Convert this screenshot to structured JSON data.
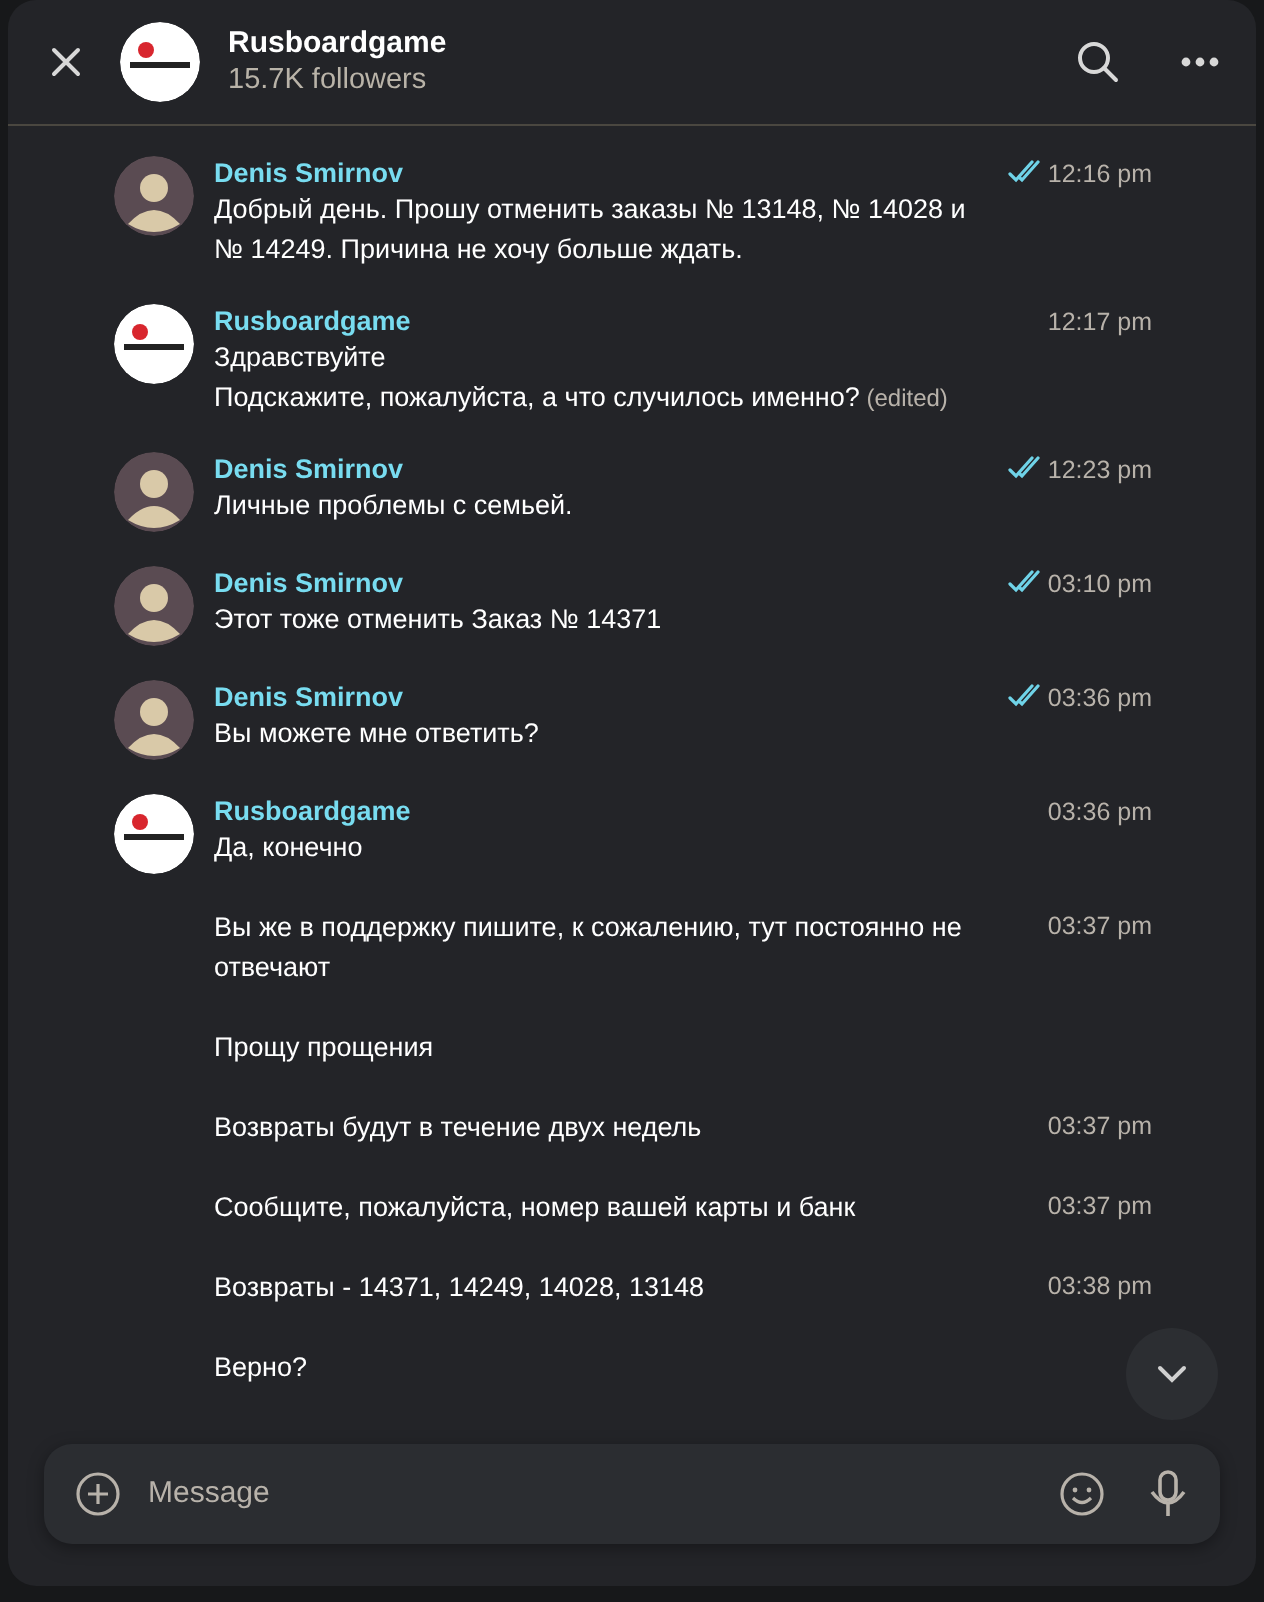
{
  "header": {
    "title": "Rusboardgame",
    "subtitle": "15.7K followers"
  },
  "groups": [
    {
      "sender": "Denis Smirnov",
      "kind": "person",
      "messages": [
        {
          "text": "Добрый день. Прошу отменить заказы № 13148, № 14028 и № 14249. Причина не хочу больше ждать.",
          "time": "12:16 pm",
          "read": true
        }
      ]
    },
    {
      "sender": "Rusboardgame",
      "kind": "logo",
      "messages": [
        {
          "text": "Здравствуйте\nПодскажите, пожалуйста, а что случилось именно?",
          "edited": "(edited)",
          "time": "12:17 pm",
          "read": false
        }
      ]
    },
    {
      "sender": "Denis Smirnov",
      "kind": "person",
      "messages": [
        {
          "text": "Личные проблемы с семьей.",
          "time": "12:23 pm",
          "read": true
        }
      ]
    },
    {
      "sender": "Denis Smirnov",
      "kind": "person",
      "messages": [
        {
          "text": "Этот тоже отменить Заказ № 14371",
          "time": "03:10 pm",
          "read": true
        }
      ]
    },
    {
      "sender": "Denis Smirnov",
      "kind": "person",
      "messages": [
        {
          "text": "Вы можете мне ответить?",
          "time": "03:36 pm",
          "read": true
        }
      ]
    },
    {
      "sender": "Rusboardgame",
      "kind": "logo",
      "messages": [
        {
          "text": "Да, конечно",
          "time": "03:36 pm",
          "read": false
        },
        {
          "text": "Вы же в поддержку пишите, к сожалению, тут постоянно не отвечают",
          "time": "03:37 pm",
          "read": false
        },
        {
          "text": "Прощу прощения",
          "read": false
        },
        {
          "text": "Возвраты будут в течение двух недель",
          "time": "03:37 pm",
          "read": false
        },
        {
          "text": "Сообщите, пожалуйста, номер вашей карты и банк",
          "time": "03:37 pm",
          "read": false
        },
        {
          "text": "Возвраты - 14371, 14249, 14028, 13148",
          "time": "03:38 pm",
          "read": false
        },
        {
          "text": "Верно?",
          "read": false
        }
      ]
    }
  ],
  "composer": {
    "placeholder": "Message"
  }
}
